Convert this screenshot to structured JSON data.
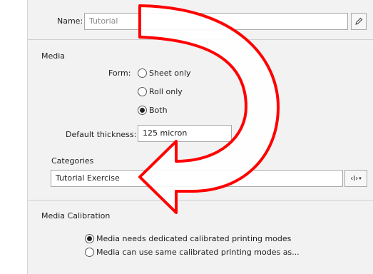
{
  "name_field": {
    "label": "Name:",
    "value": "Tutorial",
    "edit_icon": "pencil-icon"
  },
  "media": {
    "section_title": "Media",
    "form_label": "Form:",
    "form_options": [
      {
        "label": "Sheet only",
        "checked": false
      },
      {
        "label": "Roll only",
        "checked": false
      },
      {
        "label": "Both",
        "checked": true
      }
    ],
    "thickness_label": "Default thickness:",
    "thickness_value": "125 micron",
    "categories_label": "Categories",
    "categories_value": "Tutorial Exercise",
    "categories_button_icon": "insert-variable-icon",
    "categories_button_text": "‹I›"
  },
  "calibration": {
    "section_title": "Media Calibration",
    "options": [
      {
        "label": "Media needs dedicated calibrated printing modes",
        "checked": true
      },
      {
        "label": "Media can use same calibrated printing modes as...",
        "checked": false
      }
    ]
  },
  "annotation": {
    "arrow_color": "#ff0000",
    "description_icon": "curved-arrow-annotation"
  }
}
